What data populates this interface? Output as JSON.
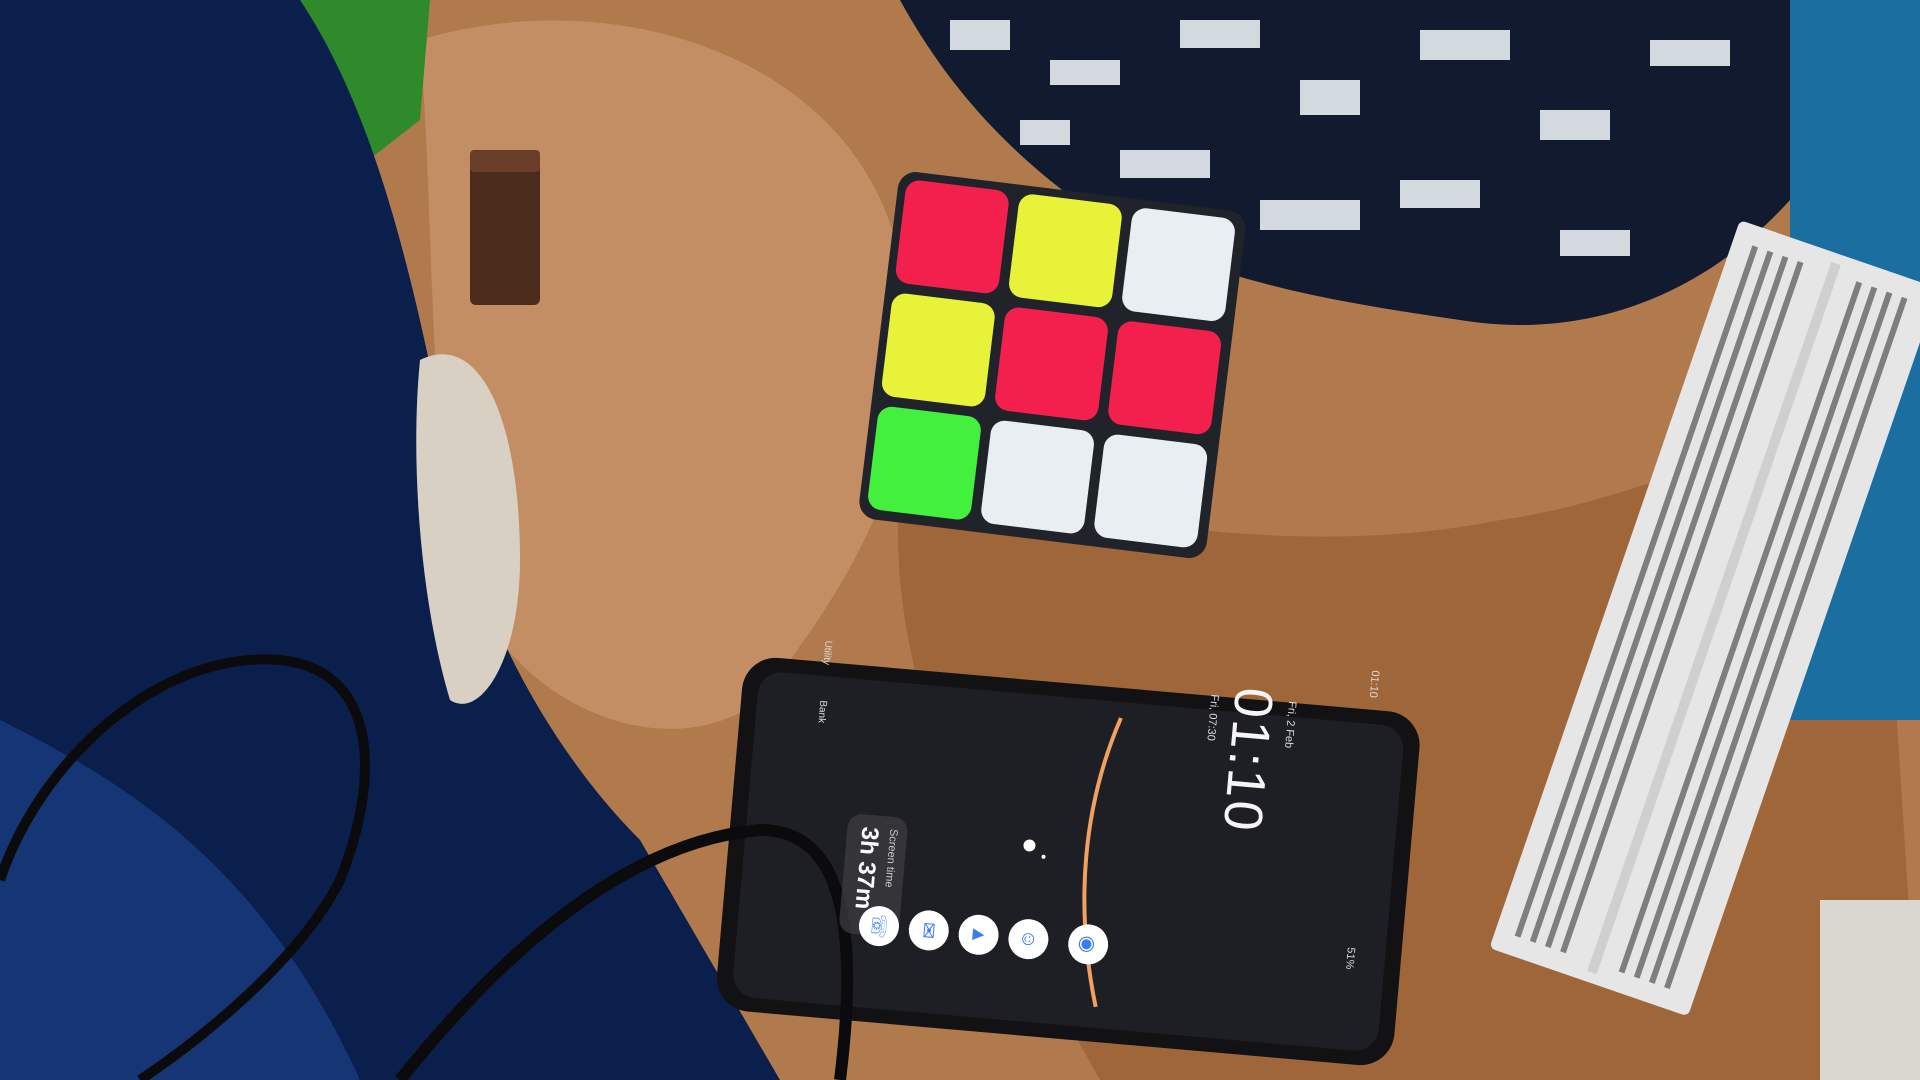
{
  "phone": {
    "status_time": "01:10",
    "status_battery": "51%",
    "lock_date": "Fri, 2 Feb",
    "lock_time": "01:10",
    "lock_alarm": "Fri, 07:30",
    "widget": {
      "label": "Screen time",
      "value": "3h 37m"
    },
    "quick_labels": {
      "battery_label": "Utility",
      "bank_label": "Bank"
    },
    "dock": [
      {
        "icon": "phone-icon"
      },
      {
        "icon": "messages-icon"
      },
      {
        "icon": "drive-icon"
      },
      {
        "icon": "contacts-icon"
      },
      {
        "icon": "camera-icon"
      }
    ]
  },
  "colors": {
    "blanket_navy": "#0a1f4c",
    "cloth_tan": "#b07a4c",
    "cube_red": "#f3204e",
    "cube_yellow": "#e8f238",
    "cube_green": "#43f03e",
    "cube_white": "#e9eef2",
    "breadboard": "#e6e6e6",
    "phone_body": "#121214"
  }
}
